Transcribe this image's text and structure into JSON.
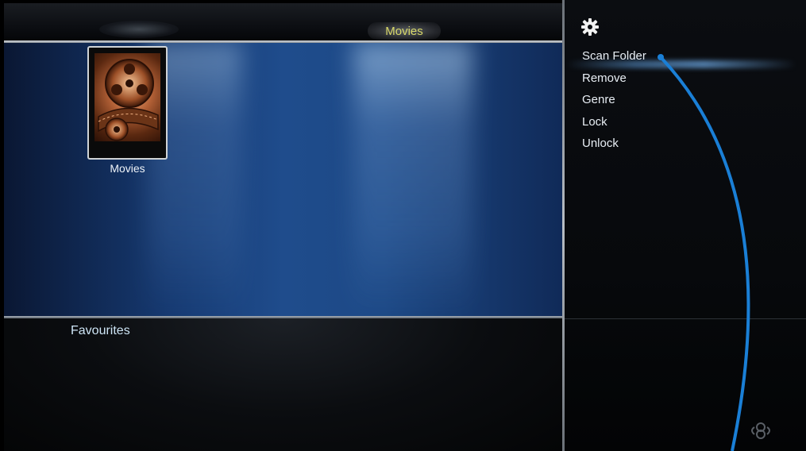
{
  "header": {
    "title": "Movies"
  },
  "tiles": [
    {
      "label": "Movies"
    }
  ],
  "lower_panel": {
    "heading": "Favourites"
  },
  "side_menu": {
    "settings_icon": "gear-icon",
    "items": [
      {
        "label": "Scan Folder"
      },
      {
        "label": "Remove"
      },
      {
        "label": "Genre"
      },
      {
        "label": "Lock"
      },
      {
        "label": "Unlock"
      }
    ],
    "footer_icon": "remote-icon"
  },
  "colors": {
    "title_text": "#d9d96a",
    "accent_arc": "#1a7fd6",
    "stage_blue": "#1f4c8c"
  }
}
